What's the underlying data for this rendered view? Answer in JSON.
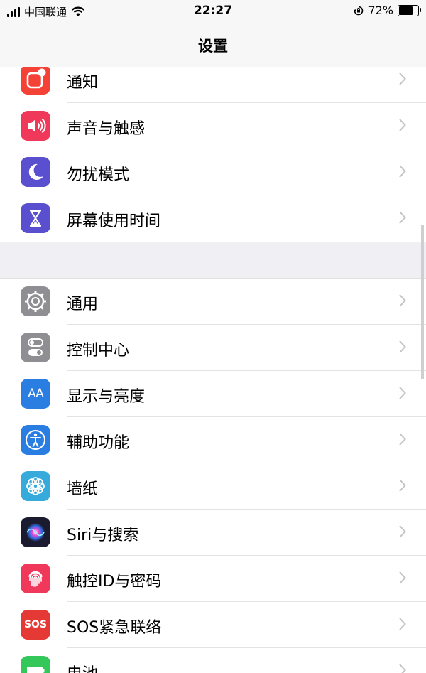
{
  "status_bar": {
    "carrier": "中国联通",
    "time": "22:27",
    "battery_percent": "72%",
    "battery_level": 0.72
  },
  "nav": {
    "title": "设置"
  },
  "groups": [
    {
      "rows": [
        {
          "label": "通知",
          "icon": "notifications-icon",
          "color": "#f44336"
        },
        {
          "label": "声音与触感",
          "icon": "sounds-icon",
          "color": "#f0385a"
        },
        {
          "label": "勿扰模式",
          "icon": "moon-icon",
          "color": "#5a4fcf"
        },
        {
          "label": "屏幕使用时间",
          "icon": "hourglass-icon",
          "color": "#5a4fcf"
        }
      ]
    },
    {
      "rows": [
        {
          "label": "通用",
          "icon": "gear-icon",
          "color": "#8e8e93"
        },
        {
          "label": "控制中心",
          "icon": "toggles-icon",
          "color": "#8e8e93"
        },
        {
          "label": "显示与亮度",
          "icon": "aa-icon",
          "color": "#2a7de1"
        },
        {
          "label": "辅助功能",
          "icon": "accessibility-icon",
          "color": "#2a7de1"
        },
        {
          "label": "墙纸",
          "icon": "flower-icon",
          "color": "#37aadc"
        },
        {
          "label": "Siri与搜索",
          "icon": "siri-icon",
          "color": "#1b1b2f"
        },
        {
          "label": "触控ID与密码",
          "icon": "fingerprint-icon",
          "color": "#f0385a"
        },
        {
          "label": "SOS紧急联络",
          "icon": "sos-icon",
          "color": "#e53935"
        },
        {
          "label": "电池",
          "icon": "battery-icon",
          "color": "#34c759"
        }
      ]
    }
  ],
  "icon_text": {
    "aa": "AA",
    "sos": "SOS"
  }
}
